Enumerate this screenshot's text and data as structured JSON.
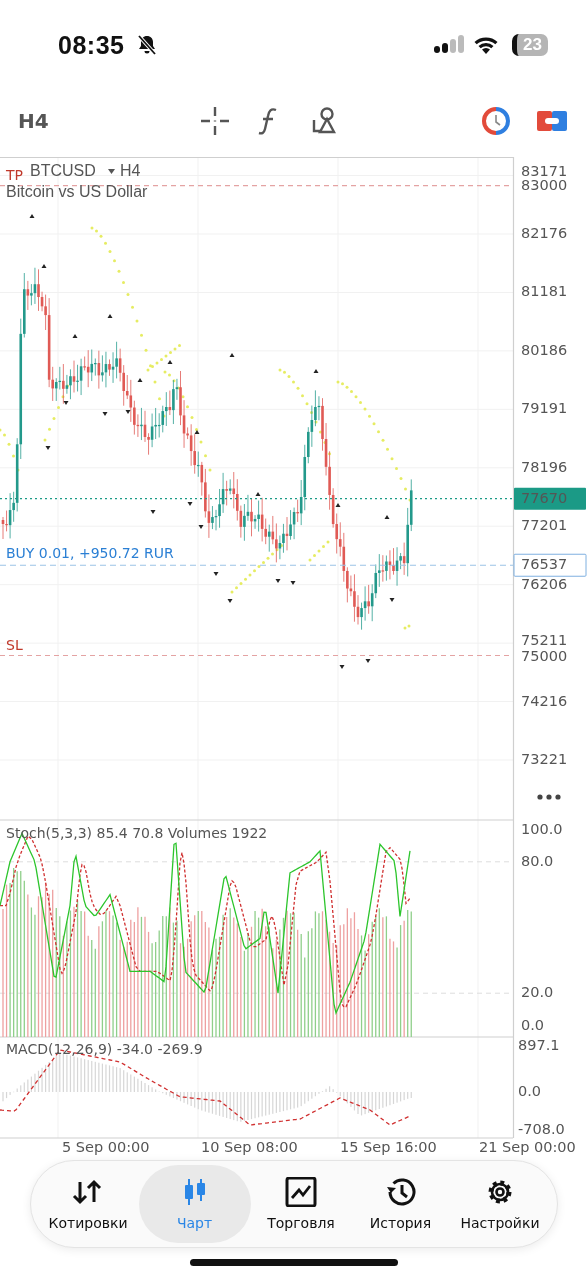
{
  "status_bar": {
    "time": "08:35",
    "battery": "23"
  },
  "toolbar": {
    "timeframe": "H4"
  },
  "chart": {
    "symbol": "BTCUSD",
    "timeframe": "H4",
    "description": "Bitcoin vs US Dollar",
    "y_labels": [
      "83171",
      "82176",
      "81181",
      "80186",
      "79191",
      "78196",
      "77201",
      "76206",
      "75211",
      "74216",
      "73221"
    ],
    "price_lines": [
      {
        "kind": "take_profit",
        "label": "TP",
        "price": "83000"
      },
      {
        "kind": "bid",
        "price": "77670"
      },
      {
        "kind": "position",
        "label": "BUY 0.01, +950.72 RUR",
        "price": "76537"
      },
      {
        "kind": "stop_loss",
        "label": "SL",
        "price": "75000"
      }
    ],
    "stoch_legend": "Stoch(5,3,3) 85.4 70.8 Volumes 1922",
    "stoch_labels": [
      "100.0",
      "80.0",
      "20.0",
      "0.0"
    ],
    "macd_legend": "MACD(12,26,9) -34.0 -269.9",
    "macd_labels": [
      "897.1",
      "0.0",
      "-708.0"
    ],
    "x_labels": [
      "5 Sep 00:00",
      "10 Sep 08:00",
      "15 Sep 16:00",
      "21 Sep 00:00"
    ]
  },
  "nav": [
    {
      "kind": "quotes",
      "label": "Котировки",
      "selected": false
    },
    {
      "kind": "chart",
      "label": "Чарт",
      "selected": true
    },
    {
      "kind": "trade",
      "label": "Торговля",
      "selected": false
    },
    {
      "kind": "history",
      "label": "История",
      "selected": false
    },
    {
      "kind": "settings",
      "label": "Настройки",
      "selected": false
    }
  ]
}
